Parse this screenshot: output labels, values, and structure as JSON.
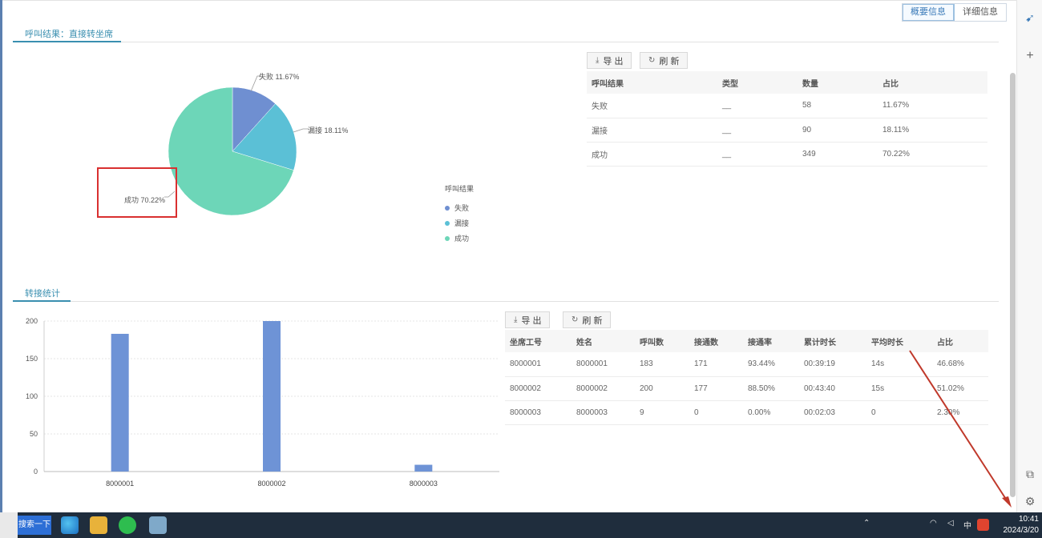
{
  "view_toggle": {
    "summary": "概要信息",
    "detail": "详细信息"
  },
  "section1": {
    "title": "呼叫结果：直接转坐席",
    "export_label": "导 出",
    "refresh_label": "刷 新",
    "pie_labels": {
      "fail": "失败 11.67%",
      "missed": "漏接 18.11%",
      "success": "成功 70.22%"
    },
    "legend": {
      "title": "呼叫结果",
      "items": [
        "失败",
        "漏接",
        "成功"
      ]
    },
    "table": {
      "headers": [
        "呼叫结果",
        "类型",
        "数量",
        "占比"
      ],
      "rows": [
        [
          "失败",
          "__",
          "58",
          "11.67%"
        ],
        [
          "漏接",
          "__",
          "90",
          "18.11%"
        ],
        [
          "成功",
          "__",
          "349",
          "70.22%"
        ]
      ]
    }
  },
  "section2": {
    "title": "转接统计",
    "export_label": "导 出",
    "refresh_label": "刷 新",
    "table": {
      "headers": [
        "坐席工号",
        "姓名",
        "呼叫数",
        "接通数",
        "接通率",
        "累计时长",
        "平均时长",
        "占比"
      ],
      "rows": [
        [
          "8000001",
          "8000001",
          "183",
          "171",
          "93.44%",
          "00:39:19",
          "14s",
          "46.68%"
        ],
        [
          "8000002",
          "8000002",
          "200",
          "177",
          "88.50%",
          "00:43:40",
          "15s",
          "51.02%"
        ],
        [
          "8000003",
          "8000003",
          "9",
          "0",
          "0.00%",
          "00:02:03",
          "0",
          "2.30%"
        ]
      ]
    }
  },
  "colors": {
    "fail": "#6f8fd1",
    "missed": "#5bc0d6",
    "success": "#6dd6b8",
    "bar": "#6e93d6",
    "accent": "#3a8fb0"
  },
  "chart_data": [
    {
      "type": "pie",
      "categories": [
        "失败",
        "漏接",
        "成功"
      ],
      "values": [
        11.67,
        18.11,
        70.22
      ],
      "legend": "right"
    },
    {
      "type": "bar",
      "categories": [
        "8000001",
        "8000002",
        "8000003"
      ],
      "values": [
        183,
        200,
        9
      ],
      "ylim": [
        0,
        200
      ],
      "yticks": [
        "0",
        "50",
        "100",
        "150",
        "200"
      ],
      "grid": true
    }
  ],
  "taskbar": {
    "search_label": "搜索一下",
    "tray": {
      "lang": "中",
      "clock_time": "10:41",
      "clock_date": "2024/3/20"
    }
  },
  "sidebar_icons": [
    "bird-icon",
    "plus-icon",
    "feedback-icon",
    "settings-icon"
  ]
}
